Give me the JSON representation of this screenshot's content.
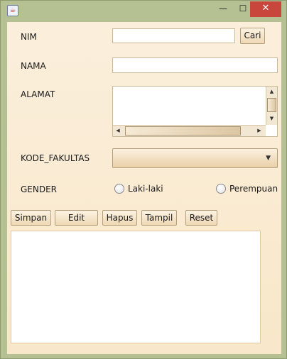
{
  "window": {
    "minimize_glyph": "—",
    "maximize_glyph": "☐",
    "close_glyph": "✕",
    "app_icon": "java-icon"
  },
  "form": {
    "nim": {
      "label": "NIM",
      "value": ""
    },
    "cari_label": "Cari",
    "nama": {
      "label": "NAMA",
      "value": ""
    },
    "alamat": {
      "label": "ALAMAT",
      "value": ""
    },
    "kode_fakultas": {
      "label": "KODE_FAKULTAS",
      "selected": ""
    },
    "gender": {
      "label": "GENDER",
      "options": [
        "Laki-laki",
        "Perempuan"
      ]
    }
  },
  "buttons": {
    "simpan": "Simpan",
    "edit": "Edit",
    "hapus": "Hapus",
    "tampil": "Tampil",
    "reset": "Reset"
  },
  "output": {
    "value": ""
  },
  "icons": {
    "scroll_up": "▲",
    "scroll_down": "▼",
    "scroll_left": "◀",
    "scroll_right": "▶",
    "dropdown": "▼"
  },
  "colors": {
    "frame": "#b6c193",
    "content_bg": "#fbefdc",
    "close_button": "#c9463d"
  }
}
